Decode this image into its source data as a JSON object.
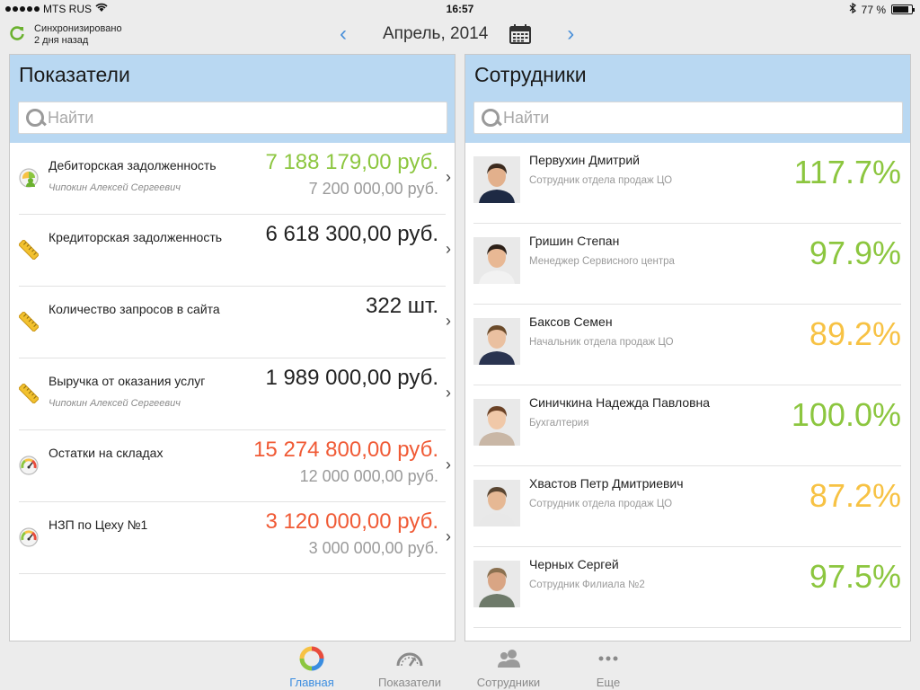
{
  "status_bar": {
    "carrier": "MTS RUS",
    "time": "16:57",
    "battery": "77 %"
  },
  "sync": {
    "line1": "Синхронизировано",
    "line2": "2 дня назад"
  },
  "period": {
    "label": "Апрель, 2014"
  },
  "indicators": {
    "title": "Показатели",
    "search_placeholder": "Найти",
    "items": [
      {
        "name": "Дебиторская задолженность",
        "person": "Чипокин Алексей Сергеевич",
        "value": "7 188 179,00 руб.",
        "target": "7 200 000,00 руб.",
        "value_color": "#8cc63f",
        "icon": "person-chart-icon"
      },
      {
        "name": "Кредиторская задолженность",
        "person": "",
        "value": "6 618 300,00 руб.",
        "target": "",
        "value_color": "#222222",
        "icon": "ruler-icon"
      },
      {
        "name": "Количество запросов в сайта",
        "person": "",
        "value": "322 шт.",
        "target": "",
        "value_color": "#222222",
        "icon": "ruler-icon"
      },
      {
        "name": "Выручка от оказания услуг",
        "person": "Чипокин Алексей Сергеевич",
        "value": "1 989 000,00 руб.",
        "target": "",
        "value_color": "#222222",
        "icon": "ruler-icon"
      },
      {
        "name": "Остатки на складах",
        "person": "",
        "value": "15 274 800,00 руб.",
        "target": "12 000 000,00 руб.",
        "value_color": "#f05a35",
        "icon": "gauge-icon"
      },
      {
        "name": "НЗП по Цеху №1",
        "person": "",
        "value": "3 120 000,00 руб.",
        "target": "3 000 000,00 руб.",
        "value_color": "#f05a35",
        "icon": "gauge-icon"
      }
    ]
  },
  "employees": {
    "title": "Сотрудники",
    "search_placeholder": "Найти",
    "items": [
      {
        "name": "Первухин Дмитрий",
        "role": "Сотрудник отдела продаж ЦО",
        "percent": "117.7%",
        "color": "#8cc63f"
      },
      {
        "name": "Гришин Степан",
        "role": "Менеджер Сервисного центра",
        "percent": "97.9%",
        "color": "#8cc63f"
      },
      {
        "name": "Баксов Семен",
        "role": "Начальник отдела продаж ЦО",
        "percent": "89.2%",
        "color": "#f7c244"
      },
      {
        "name": "Синичкина Надежда Павловна",
        "role": "Бухгалтерия",
        "percent": "100.0%",
        "color": "#8cc63f"
      },
      {
        "name": "Хвастов Петр Дмитриевич",
        "role": "Сотрудник отдела продаж ЦО",
        "percent": "87.2%",
        "color": "#f7c244"
      },
      {
        "name": "Черных Сергей",
        "role": "Сотрудник Филиала №2",
        "percent": "97.5%",
        "color": "#8cc63f"
      }
    ]
  },
  "tabs": [
    {
      "label": "Главная",
      "icon": "home-ring-icon",
      "active": true
    },
    {
      "label": "Показатели",
      "icon": "speedometer-icon",
      "active": false
    },
    {
      "label": "Сотрудники",
      "icon": "people-icon",
      "active": false
    },
    {
      "label": "Еще",
      "icon": "more-dots-icon",
      "active": false
    }
  ],
  "colors": {
    "accent": "#3a8de0",
    "header_bg": "#b9d8f2",
    "positive": "#8cc63f",
    "warning": "#f7c244",
    "negative": "#f05a35"
  }
}
